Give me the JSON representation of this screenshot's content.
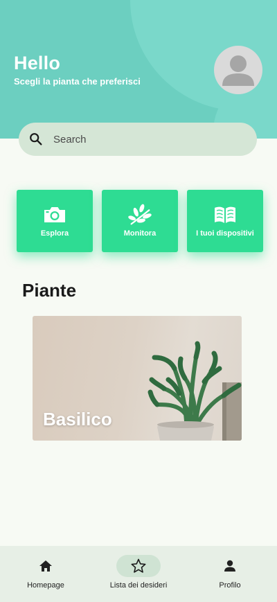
{
  "header": {
    "title": "Hello",
    "subtitle": "Scegli la pianta che preferisci",
    "avatar_icon": "user-avatar-icon"
  },
  "search": {
    "placeholder": "Search",
    "value": ""
  },
  "actions": [
    {
      "label": "Esplora",
      "icon": "camera-icon"
    },
    {
      "label": "Monitora",
      "icon": "plant-leaves-icon"
    },
    {
      "label": "I tuoi dispositivi",
      "icon": "open-book-icon"
    }
  ],
  "section": {
    "title": "Piante"
  },
  "plants": [
    {
      "name": "Basilico"
    }
  ],
  "bottom_nav": {
    "items": [
      {
        "label": "Homepage",
        "icon": "home-icon",
        "active": false
      },
      {
        "label": "Lista dei desideri",
        "icon": "star-outline-icon",
        "active": true
      },
      {
        "label": "Profilo",
        "icon": "person-icon",
        "active": false
      }
    ]
  },
  "colors": {
    "header": "#6ccfc0",
    "accent_button": "#2edc93",
    "search_bg": "#d5e6d6",
    "nav_bg": "#e7efe6",
    "page_bg": "#f7faf4"
  }
}
